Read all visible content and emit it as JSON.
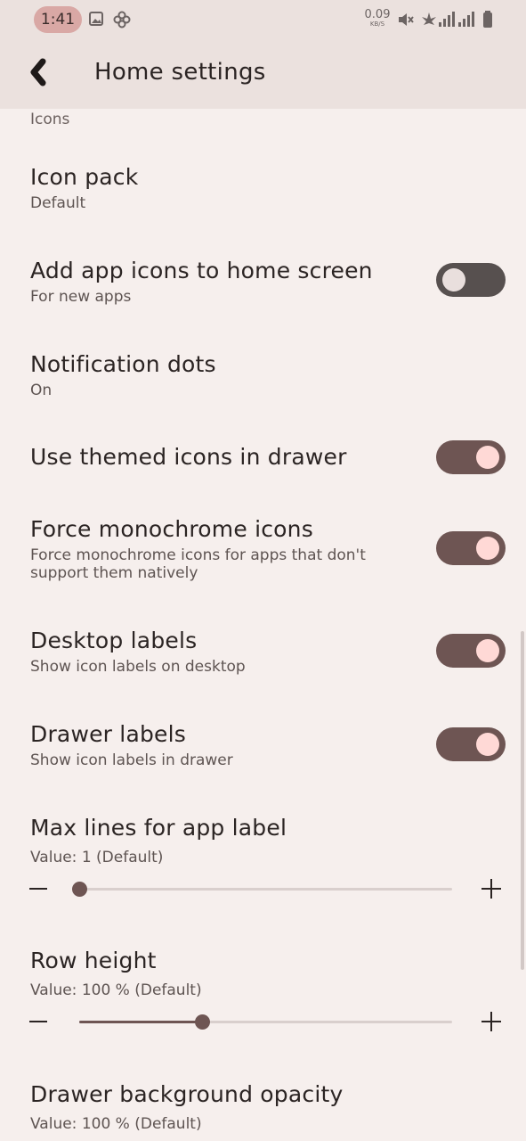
{
  "status_bar": {
    "time": "1:41",
    "net_speed_value": "0.09",
    "net_speed_unit": "KB/S",
    "icons": [
      "image-icon",
      "pinwheel-icon",
      "mute-icon",
      "signal-icon",
      "battery-icon"
    ]
  },
  "toolbar": {
    "title": "Home settings"
  },
  "section": {
    "header": "Icons"
  },
  "settings": [
    {
      "title": "Icon pack",
      "subtitle": "Default"
    },
    {
      "title": "Add app icons to home screen",
      "subtitle": "For new apps",
      "toggle": "off"
    },
    {
      "title": "Notification dots",
      "subtitle": "On"
    },
    {
      "title": "Use themed icons in drawer",
      "toggle": "on"
    },
    {
      "title": "Force monochrome icons",
      "subtitle": "Force monochrome icons for apps that don't support them natively",
      "toggle": "on"
    },
    {
      "title": "Desktop labels",
      "subtitle": "Show icon labels on desktop",
      "toggle": "on"
    },
    {
      "title": "Drawer labels",
      "subtitle": "Show icon labels in drawer",
      "toggle": "on"
    }
  ],
  "sliders": [
    {
      "title": "Max lines for app label",
      "value_text": "Value: 1  (Default)",
      "fraction": 0.0
    },
    {
      "title": "Row height",
      "value_text": "Value: 100 % (Default)",
      "fraction": 0.33
    },
    {
      "title": "Drawer background opacity",
      "value_text": "Value: 100 % (Default)"
    }
  ],
  "colors": {
    "background": "#f6efed",
    "toolbar": "#ebe1de",
    "accent": "#6e5553",
    "toggle_knob_on": "#ffd9d6",
    "time_pill": "#d9a8a5"
  }
}
